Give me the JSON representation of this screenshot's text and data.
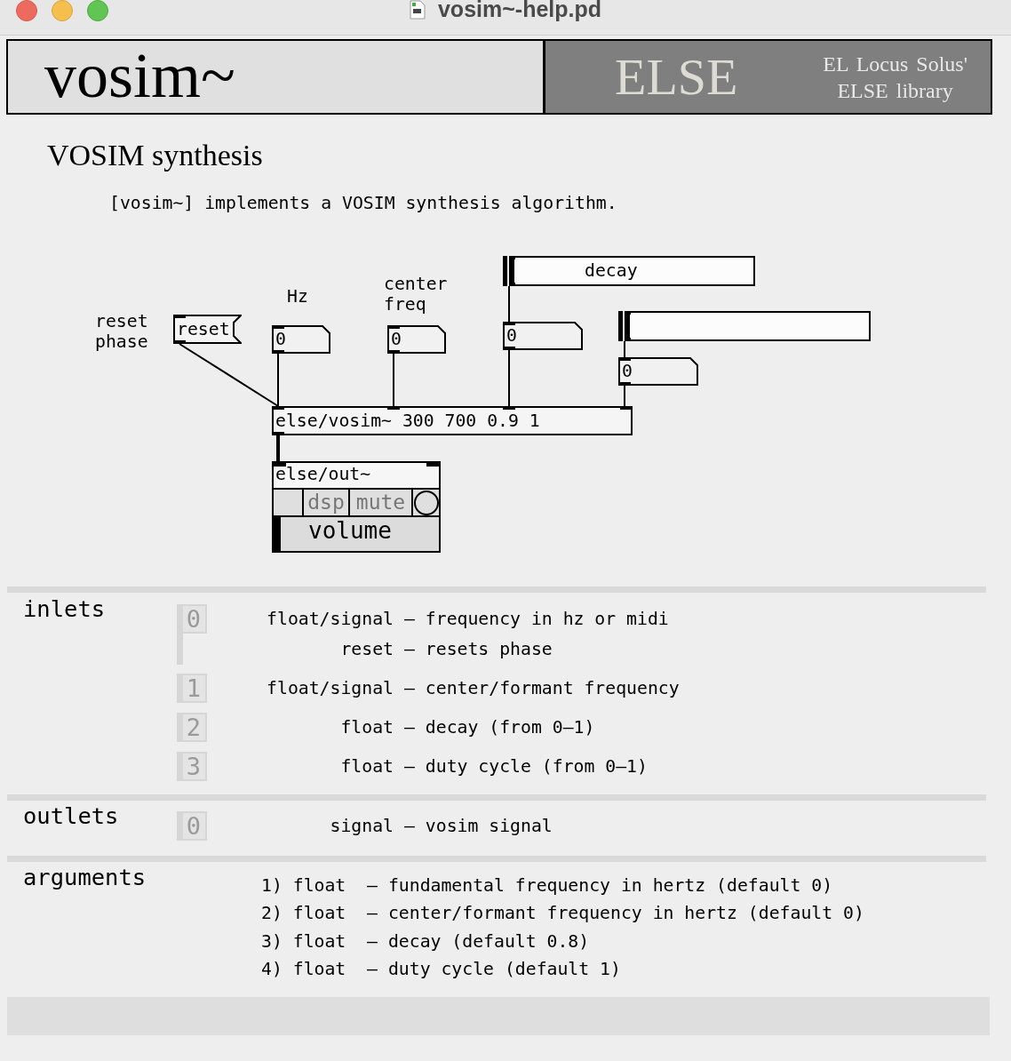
{
  "window": {
    "title": "vosim~-help.pd"
  },
  "header": {
    "object_name": "vosim~",
    "library": "ELSE",
    "credits": [
      "EL Locus Solus'",
      "ELSE library"
    ]
  },
  "heading": "VOSIM synthesis",
  "description": "[vosim~] implements a VOSIM synthesis algorithm.",
  "patch": {
    "nodes": [
      {
        "kind": "comment",
        "lines": [
          "reset",
          "phase"
        ]
      },
      {
        "kind": "comment",
        "lines": [
          "Hz"
        ]
      },
      {
        "kind": "comment",
        "lines": [
          "center",
          "freq"
        ]
      },
      {
        "kind": "message",
        "text": "reset"
      },
      {
        "kind": "number",
        "value": "0"
      },
      {
        "kind": "number",
        "value": "0"
      },
      {
        "kind": "slider",
        "label": "decay",
        "level": 0
      },
      {
        "kind": "number",
        "value": "0"
      },
      {
        "kind": "slider",
        "level": 0
      },
      {
        "kind": "number",
        "value": "0"
      },
      {
        "kind": "object",
        "text": "else/vosim~ 300 700 0.9 1"
      },
      {
        "kind": "output",
        "text": "else/out~",
        "dsp": {
          "label": "dsp",
          "on": false
        },
        "mute": {
          "label": "mute",
          "on": false
        },
        "volume": {
          "label": "volume",
          "level": 0
        }
      }
    ]
  },
  "inlets": {
    "title": "inlets",
    "items": [
      {
        "number": "0",
        "lines": [
          {
            "type": "float/signal",
            "description": "– frequency in hz or midi"
          },
          {
            "type": "reset",
            "description": "– resets phase"
          }
        ]
      },
      {
        "number": "1",
        "lines": [
          {
            "type": "float/signal",
            "description": "– center/formant frequency"
          }
        ]
      },
      {
        "number": "2",
        "lines": [
          {
            "type": "float",
            "description": "– decay (from 0–1)"
          }
        ]
      },
      {
        "number": "3",
        "lines": [
          {
            "type": "float",
            "description": "– duty cycle (from 0–1)"
          }
        ]
      }
    ]
  },
  "outlets": {
    "title": "outlets",
    "items": [
      {
        "number": "0",
        "lines": [
          {
            "type": "signal",
            "description": "– vosim signal"
          }
        ]
      }
    ]
  },
  "arguments": {
    "title": "arguments",
    "lines": [
      "1) float  – fundamental frequency in hertz (default 0)",
      "2) float  – center/formant frequency in hertz (default 0)",
      "3) float  – decay (default 0.8)",
      "4) float  – duty cycle (default 1)"
    ]
  }
}
